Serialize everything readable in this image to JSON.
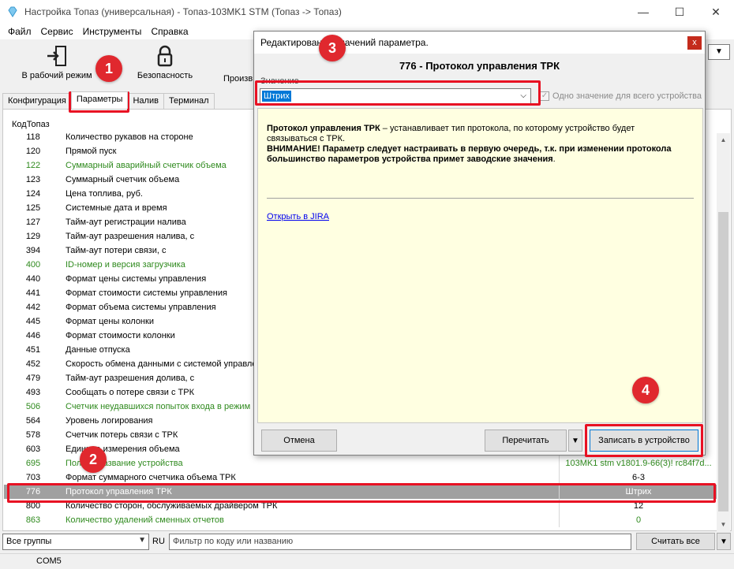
{
  "window": {
    "title": "Настройка Топаз (универсальная) - Топаз-103MK1 STM (Топаз -> Топаз)",
    "minimize": "—",
    "maximize": "☐",
    "close": "✕"
  },
  "menu": [
    "Файл",
    "Сервис",
    "Инструменты",
    "Справка"
  ],
  "toolbar": {
    "work_mode": "В рабочий режим",
    "security": "Безопасность",
    "third": "Произв"
  },
  "tabs": [
    "Конфигурация",
    "Параметры",
    "Налив",
    "Терминал"
  ],
  "table": {
    "col_code": "КодТопаз",
    "rows": [
      {
        "code": "118",
        "name": "Количество рукавов на стороне",
        "value": "",
        "green": false
      },
      {
        "code": "120",
        "name": "Прямой пуск",
        "value": "",
        "green": false
      },
      {
        "code": "122",
        "name": "Суммарный аварийный счетчик объема",
        "value": "",
        "green": true
      },
      {
        "code": "123",
        "name": "Суммарный счетчик объема",
        "value": "",
        "green": false
      },
      {
        "code": "124",
        "name": "Цена топлива, руб.",
        "value": "",
        "green": false
      },
      {
        "code": "125",
        "name": "Системные дата и время",
        "value": "",
        "green": false
      },
      {
        "code": "127",
        "name": "Тайм-аут регистрации налива",
        "value": "",
        "green": false
      },
      {
        "code": "129",
        "name": "Тайм-аут разрешения налива, с",
        "value": "",
        "green": false
      },
      {
        "code": "394",
        "name": "Тайм-аут потери связи, с",
        "value": "",
        "green": false
      },
      {
        "code": "400",
        "name": "ID-номер и версия загрузчика",
        "value": "",
        "green": true
      },
      {
        "code": "440",
        "name": "Формат цены системы управления",
        "value": "",
        "green": false
      },
      {
        "code": "441",
        "name": "Формат стоимости системы управления",
        "value": "",
        "green": false
      },
      {
        "code": "442",
        "name": "Формат объема системы управления",
        "value": "",
        "green": false
      },
      {
        "code": "445",
        "name": "Формат цены колонки",
        "value": "",
        "green": false
      },
      {
        "code": "446",
        "name": "Формат стоимости колонки",
        "value": "",
        "green": false
      },
      {
        "code": "451",
        "name": "Данные отпуска",
        "value": "",
        "green": false
      },
      {
        "code": "452",
        "name": "Скорость обмена данными с системой управлен",
        "value": "",
        "green": false
      },
      {
        "code": "479",
        "name": "Тайм-аут разрешения долива, с",
        "value": "",
        "green": false
      },
      {
        "code": "493",
        "name": "Сообщать о потере связи с ТРК",
        "value": "",
        "green": false
      },
      {
        "code": "506",
        "name": "Счетчик неудавшихся попыток входа в режим",
        "value": "",
        "green": true
      },
      {
        "code": "564",
        "name": "Уровень логирования",
        "value": "",
        "green": false
      },
      {
        "code": "578",
        "name": "Счетчик потерь связи с ТРК",
        "value": "",
        "green": false
      },
      {
        "code": "603",
        "name": "Единица измерения объема",
        "value": "",
        "green": false
      },
      {
        "code": "695",
        "name": "Полное название устройства",
        "value": "103MK1 stm v1801.9-66(3)! rc84f7d...",
        "green": true
      },
      {
        "code": "703",
        "name": "Формат суммарного счетчика объема ТРК",
        "value": "6-3",
        "green": false
      },
      {
        "code": "776",
        "name": "Протокол управления ТРК",
        "value": "Штрих",
        "green": false,
        "selected": true
      },
      {
        "code": "800",
        "name": "Количество сторон, обслуживаемых драйвером ТРК",
        "value": "12",
        "green": false
      },
      {
        "code": "863",
        "name": "Количество удалений сменных отчетов",
        "value": "0",
        "green": true
      }
    ]
  },
  "bottom": {
    "groups": "Все группы",
    "lang": "RU",
    "filter_placeholder": "Фильтр по коду или названию",
    "read_all": "Считать все"
  },
  "status": {
    "port": "COM5"
  },
  "dialog": {
    "title": "Редактирование значений параметра.",
    "heading": "776 - Протокол управления ТРК",
    "value_label": "Значение",
    "value": "Штрих",
    "single_value_label": "Одно значение для всего устройства",
    "desc_bold": "Протокол управления ТРК",
    "desc_text": " – устанавливает тип протокола, по которому устройство будет связываться с ТРК.",
    "desc_warning": "ВНИМАНИЕ! Параметр следует настраивать в первую очередь, т.к. при изменении протокола большинство параметров устройства примет заводские значения",
    "desc_end": ".",
    "jira_link": "Открыть в JIRA",
    "cancel": "Отмена",
    "reread": "Перечитать",
    "write": "Записать в устройство",
    "close": "x"
  },
  "annotations": {
    "b1": "1",
    "b2": "2",
    "b3": "3",
    "b4": "4"
  },
  "colors": {
    "green_text": "#2f8a1e",
    "selected_row": "#a0a0a0",
    "annotation_red": "#e81123",
    "info_bg": "#ffffe1"
  }
}
